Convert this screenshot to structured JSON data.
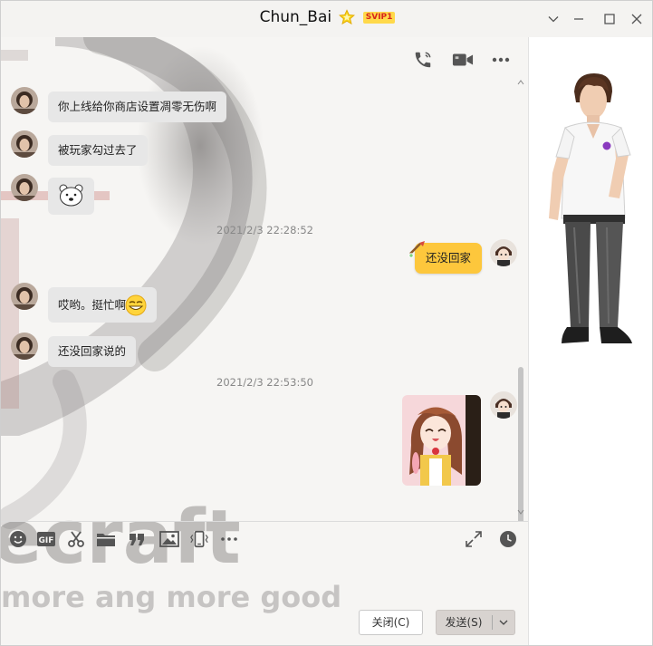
{
  "window": {
    "title": "Chun_Bai",
    "badge": "SVIP1",
    "accent_color": "#fdc73c"
  },
  "background": {
    "watermark_line1": "ecraft",
    "watermark_line2": "more ang more good"
  },
  "messages": [
    {
      "type": "in",
      "text": "你上线给你商店设置凋零无伤啊"
    },
    {
      "type": "in",
      "text": "被玩家勾过去了"
    },
    {
      "type": "in",
      "sticker": "polar-bear-emoji"
    },
    {
      "type": "time",
      "text": "2021/2/3 22:28:52"
    },
    {
      "type": "out",
      "text": "还没回家"
    },
    {
      "type": "in",
      "text": "哎哟。挺忙啊",
      "emoji": "grin-emoji"
    },
    {
      "type": "in",
      "text": "还没回家说的"
    },
    {
      "type": "time",
      "text": "2021/2/3 22:53:50"
    },
    {
      "type": "out",
      "image": "anime-dog-girl-photo"
    }
  ],
  "toolbar": {
    "items": [
      "smile-icon",
      "gif-icon",
      "scissors-icon",
      "folder-icon",
      "quote-icon",
      "image-icon",
      "shake-icon",
      "more-icon"
    ],
    "right_items": [
      "expand-icon",
      "history-clock-icon"
    ]
  },
  "buttons": {
    "close_label": "关闭(C)",
    "send_label": "发送(S)"
  },
  "icons": {
    "top_actions": [
      "phone-icon",
      "video-icon",
      "more-icon"
    ]
  }
}
